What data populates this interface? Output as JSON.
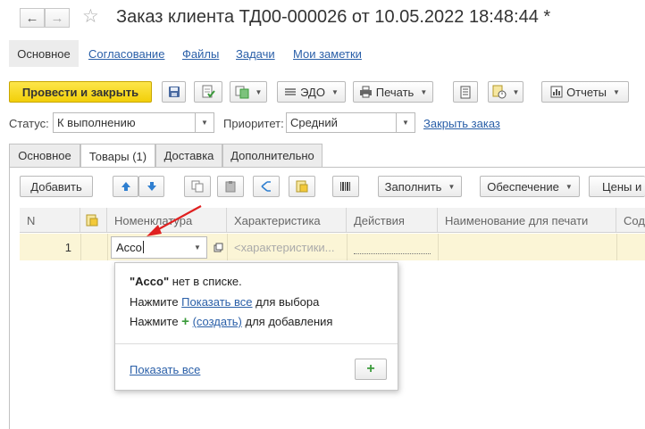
{
  "window": {
    "title": "Заказ клиента ТД00-000026 от 10.05.2022 18:48:44 *"
  },
  "nav_links": [
    {
      "label": "Основное",
      "active": true
    },
    {
      "label": "Согласование"
    },
    {
      "label": "Файлы"
    },
    {
      "label": "Задачи"
    },
    {
      "label": "Мои заметки"
    }
  ],
  "toolbar": {
    "post_close": "Провести и закрыть",
    "edo": "ЭДО",
    "print": "Печать",
    "reports": "Отчеты"
  },
  "status": {
    "label": "Статус:",
    "value": "К выполнению",
    "priority_label": "Приоритет:",
    "priority_value": "Средний",
    "close_order": "Закрыть заказ"
  },
  "tabs": [
    {
      "label": "Основное"
    },
    {
      "label": "Товары (1)",
      "active": true
    },
    {
      "label": "Доставка"
    },
    {
      "label": "Дополнительно"
    }
  ],
  "table_toolbar": {
    "add": "Добавить",
    "fill": "Заполнить",
    "provision": "Обеспечение",
    "prices": "Цены и с"
  },
  "table": {
    "columns": [
      "N",
      "Номенклатура",
      "Характеристика",
      "Действия",
      "Наименование для печати",
      "Сод"
    ],
    "row": {
      "n": "1",
      "nomenclature": "Acco",
      "characteristic_placeholder": "<характеристики..."
    }
  },
  "popup": {
    "quoted": "\"Acco\"",
    "not_in_list": " нет в списке.",
    "press": "Нажмите ",
    "show_all_link": "Показать все",
    "for_select": " для выбора",
    "create_link": "(создать)",
    "for_add": " для добавления",
    "show_all_footer": "Показать все"
  },
  "colors": {
    "primary_button": "#f5d41f",
    "link": "#2a5fa8",
    "row_highlight": "#fbf5d6",
    "plus_green": "#3a9a3a",
    "arrow_red": "#e02020"
  }
}
